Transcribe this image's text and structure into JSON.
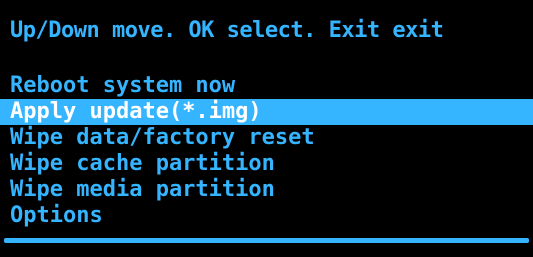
{
  "header": {
    "instructions": "Up/Down move. OK select. Exit exit"
  },
  "menu": {
    "selected_index": 1,
    "items": [
      {
        "label": "Reboot system now"
      },
      {
        "label": "Apply update(*.img)"
      },
      {
        "label": "Wipe data/factory reset"
      },
      {
        "label": "Wipe cache partition"
      },
      {
        "label": "Wipe media partition"
      },
      {
        "label": "Options"
      }
    ]
  },
  "colors": {
    "background": "#000000",
    "text": "#35b4ff",
    "highlight": "#35b4ff",
    "highlight_text": "#ffffff"
  }
}
